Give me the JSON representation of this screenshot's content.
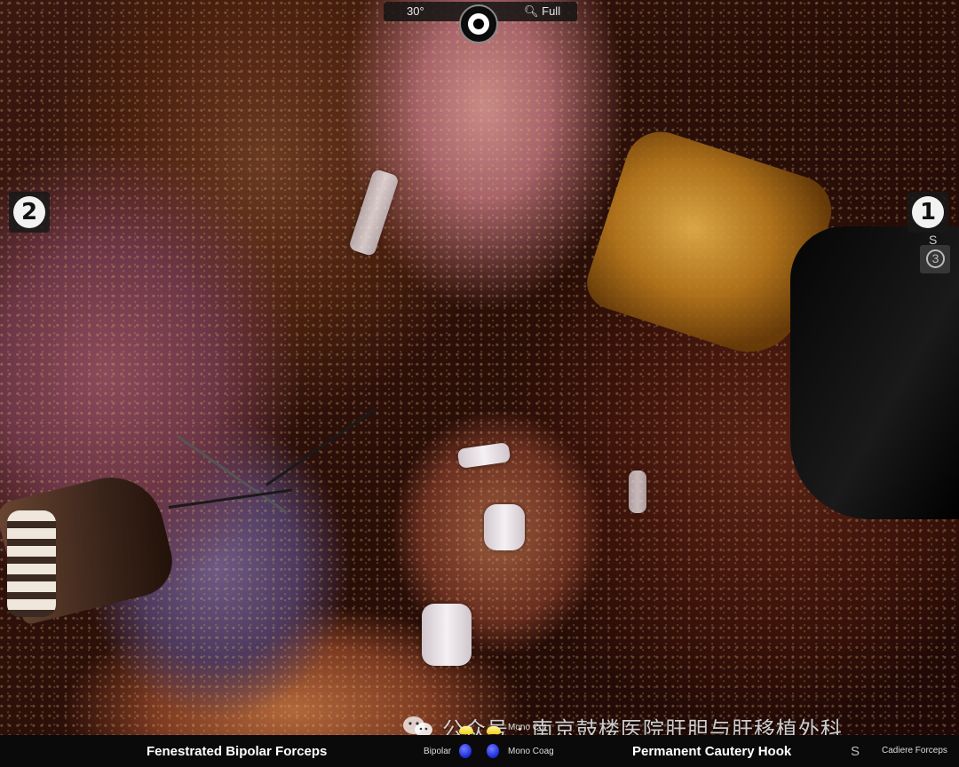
{
  "hud": {
    "scope_angle": "30°",
    "zoom_mode": "Full",
    "left_arm_number": "2",
    "right_arm_number": "1",
    "swap_indicator": "S",
    "standby_arm_number": "3"
  },
  "bottom_bar": {
    "left_instrument": "Fenestrated Bipolar Forceps",
    "left_pedal_label": "Bipolar",
    "right_pedal_cut": "Mono Cut",
    "right_pedal_coag": "Mono Coag",
    "right_instrument": "Permanent Cautery Hook",
    "right_indicator": "S",
    "standby_instrument": "Cadiere Forceps"
  },
  "watermark": {
    "text": "公众号 · 南京鼓楼医院肝胆与肝移植外科"
  },
  "colors": {
    "pedal_blue": "#1b2ad8",
    "pedal_yellow": "#f2d21a",
    "hud_background": "#141414"
  }
}
